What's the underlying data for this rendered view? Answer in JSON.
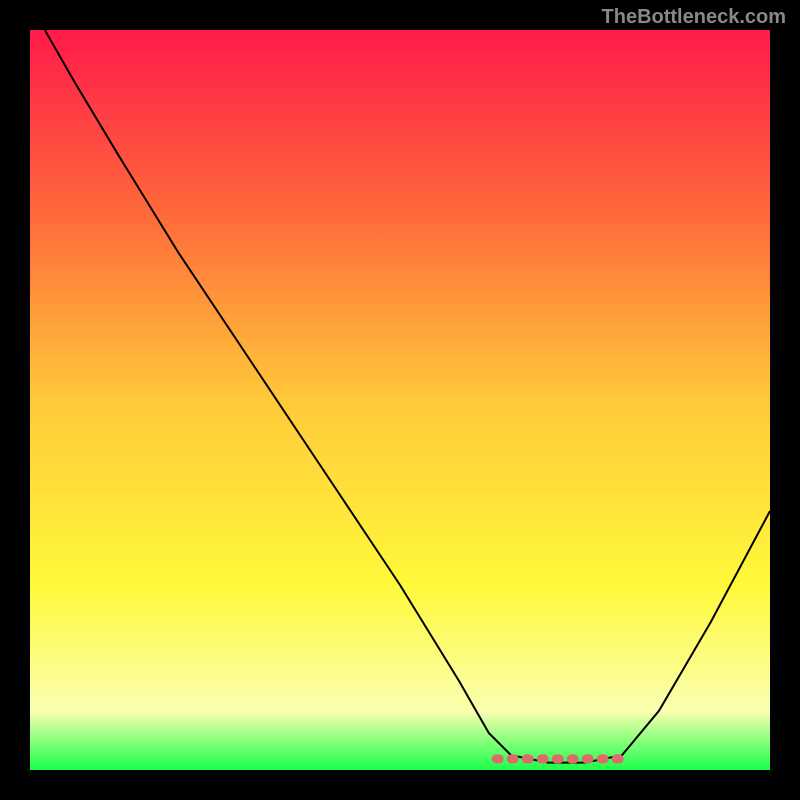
{
  "watermark": "TheBottleneck.com",
  "chart_data": {
    "type": "line",
    "title": "",
    "xlabel": "",
    "ylabel": "",
    "xlim": [
      0,
      100
    ],
    "ylim": [
      0,
      100
    ],
    "background_gradient": {
      "stops": [
        {
          "offset": 0,
          "color": "#ff1a4a"
        },
        {
          "offset": 25,
          "color": "#ff6a3a"
        },
        {
          "offset": 50,
          "color": "#ffc93a"
        },
        {
          "offset": 75,
          "color": "#fff93a"
        },
        {
          "offset": 92,
          "color": "#faffb0"
        },
        {
          "offset": 100,
          "color": "#1aff4a"
        }
      ]
    },
    "series": [
      {
        "name": "bottleneck-curve",
        "color": "#000000",
        "points": [
          {
            "x": 2,
            "y": 100
          },
          {
            "x": 6,
            "y": 93
          },
          {
            "x": 12,
            "y": 83
          },
          {
            "x": 20,
            "y": 70
          },
          {
            "x": 30,
            "y": 55
          },
          {
            "x": 40,
            "y": 40
          },
          {
            "x": 50,
            "y": 25
          },
          {
            "x": 58,
            "y": 12
          },
          {
            "x": 62,
            "y": 5
          },
          {
            "x": 65,
            "y": 2
          },
          {
            "x": 70,
            "y": 1
          },
          {
            "x": 75,
            "y": 1
          },
          {
            "x": 80,
            "y": 2
          },
          {
            "x": 85,
            "y": 8
          },
          {
            "x": 92,
            "y": 20
          },
          {
            "x": 100,
            "y": 35
          }
        ]
      }
    ],
    "highlight": {
      "name": "optimal-range",
      "color": "#e06a6a",
      "x_start": 63,
      "x_end": 80,
      "y": 1.5
    }
  }
}
